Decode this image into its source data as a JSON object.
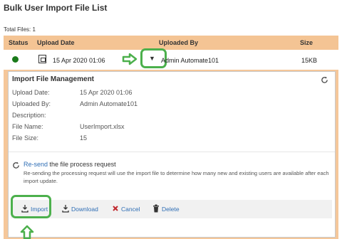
{
  "page": {
    "title": "Bulk User Import File List",
    "total_label": "Total Files:",
    "total_value": "1"
  },
  "table": {
    "headers": {
      "status": "Status",
      "upload_date": "Upload Date",
      "uploaded_by": "Uploaded By",
      "size": "Size"
    },
    "row": {
      "status_color": "#1a7a1a",
      "icon": "file-icon",
      "date": "15 Apr 2020 01:06",
      "uploader": "Admin Automate101",
      "size": "15KB"
    }
  },
  "panel": {
    "title": "Import File Management",
    "fields": [
      {
        "label": "Upload Date:",
        "value": "15 Apr 2020 01:06"
      },
      {
        "label": "Uploaded By:",
        "value": "Admin Automate101"
      },
      {
        "label": "Description:",
        "value": ""
      },
      {
        "label": "File Name:",
        "value": "UserImport.xlsx"
      },
      {
        "label": "File Size:",
        "value": "15"
      }
    ],
    "resend": {
      "link": "Re-send",
      "text": " the file process request",
      "note": "Re-sending the processing request will use the import file to determine how many new and existing users are available after each import update."
    },
    "actions": {
      "import": "Import",
      "download": "Download",
      "cancel": "Cancel",
      "delete": "Delete"
    }
  },
  "colors": {
    "header_bg": "#f4c494",
    "link": "#2f6eb5",
    "highlight": "#4cb04c",
    "cancel": "#c0282d"
  }
}
